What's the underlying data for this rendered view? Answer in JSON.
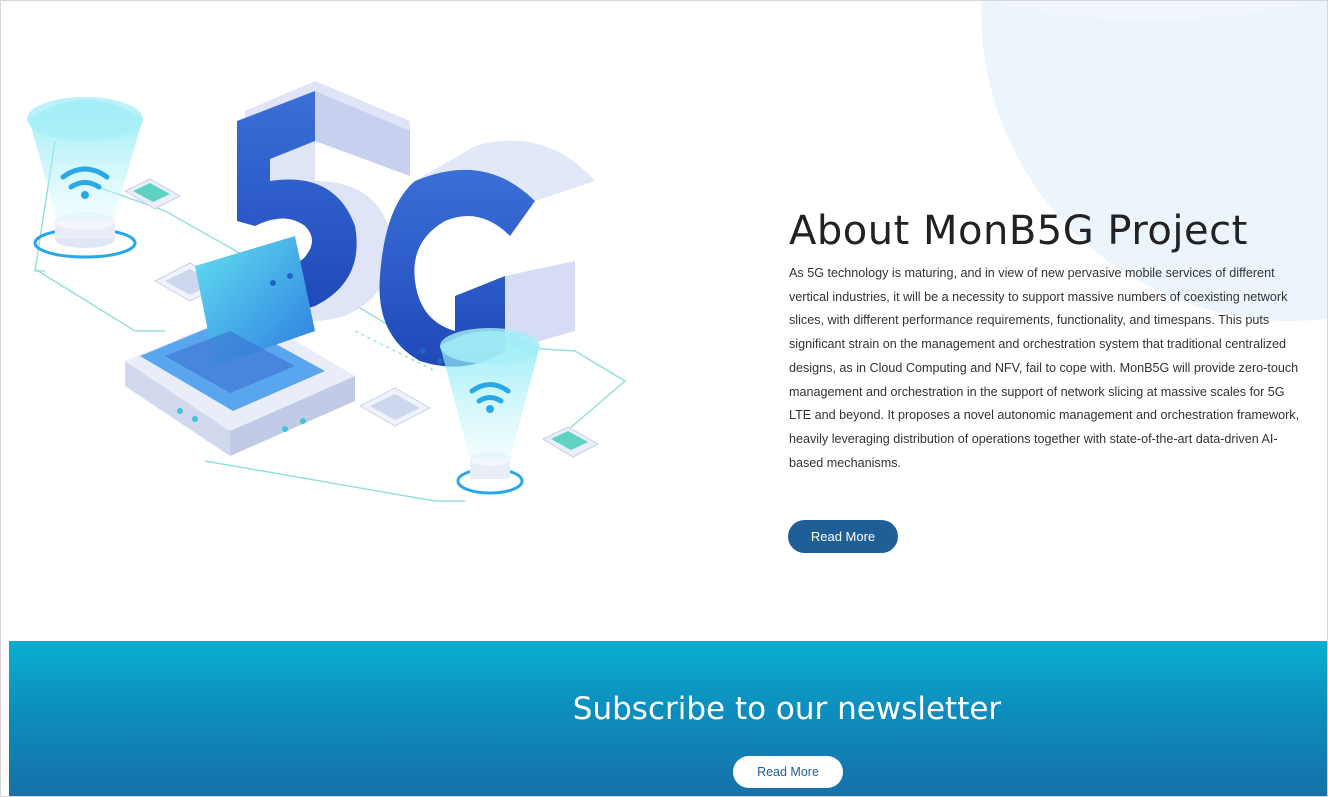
{
  "about": {
    "title": "About MonB5G Project",
    "body": "As 5G technology is maturing, and in view of new pervasive mobile services of different vertical industries, it will be a necessity to support massive numbers of coexisting network slices, with different performance requirements, functionality, and timespans. This puts significant strain on the management and orchestration system that traditional centralized designs, as in Cloud Computing and NFV, fail to cope with. MonB5G will provide zero-touch management and orchestration in the support of network slicing at massive scales for 5G LTE and beyond. It proposes a novel autonomic management and orchestration framework, heavily leveraging distribution of operations together with state-of-the-art data-driven AI-based mechanisms.",
    "read_more_label": "Read More",
    "illustration": {
      "icon": "5g-network-illustration-icon",
      "big_text": "5G"
    }
  },
  "newsletter": {
    "title": "Subscribe to our newsletter",
    "read_more_label": "Read More"
  },
  "colors": {
    "primary_button": "#1f5f97",
    "banner_top": "#0aaed0",
    "banner_bottom": "#1670a8",
    "glow": "#6fe2f2"
  }
}
